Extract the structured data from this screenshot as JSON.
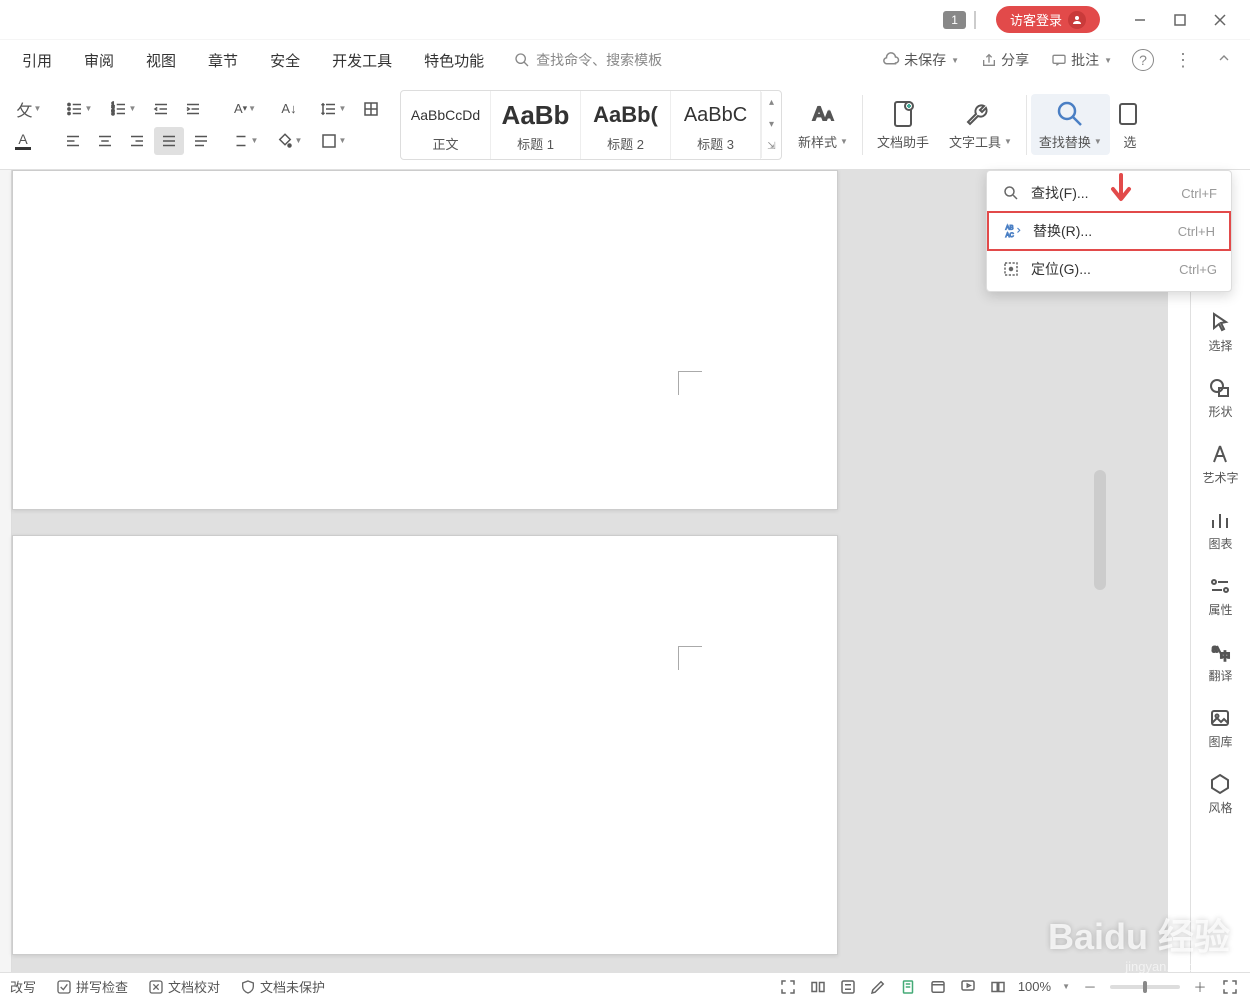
{
  "titlebar": {
    "tab_number": "1",
    "guest_login": "访客登录"
  },
  "menu": {
    "items": [
      "引用",
      "审阅",
      "视图",
      "章节",
      "安全",
      "开发工具",
      "特色功能"
    ],
    "search_placeholder": "查找命令、搜索模板",
    "unsaved": "未保存",
    "share": "分享",
    "annotations": "批注"
  },
  "ribbon": {
    "styles": [
      {
        "preview": "AaBbCcDd",
        "label": "正文"
      },
      {
        "preview": "AaBb",
        "label": "标题 1"
      },
      {
        "preview": "AaBb(",
        "label": "标题 2"
      },
      {
        "preview": "AaBbC",
        "label": "标题 3"
      }
    ],
    "new_style": "新样式",
    "doc_assistant": "文档助手",
    "text_tools": "文字工具",
    "find_replace": "查找替换",
    "select_cut": "选"
  },
  "dropdown": {
    "find": {
      "label": "查找(F)...",
      "shortcut": "Ctrl+F"
    },
    "replace": {
      "label": "替换(R)...",
      "shortcut": "Ctrl+H"
    },
    "goto": {
      "label": "定位(G)...",
      "shortcut": "Ctrl+G"
    }
  },
  "sidebar": {
    "select": "选择",
    "shape": "形状",
    "wordart": "艺术字",
    "chart": "图表",
    "properties": "属性",
    "translate": "翻译",
    "gallery": "图库",
    "style": "风格"
  },
  "statusbar": {
    "overwrite": "改写",
    "spellcheck": "拼写检查",
    "doc_proof": "文档校对",
    "doc_unprotected": "文档未保护",
    "zoom": "100%"
  },
  "watermark": {
    "main": "Baidu 经验",
    "sub": "jingyan.baidu.com"
  }
}
